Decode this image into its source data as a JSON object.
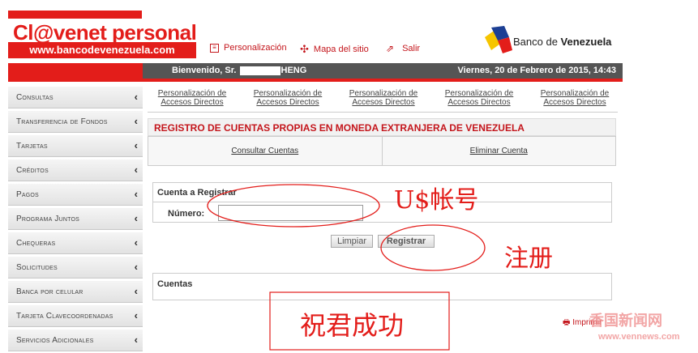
{
  "header": {
    "logo_text": "Cl@venet personal",
    "logo_url": "www.bancodevenezuela.com",
    "bank_name_prefix": "Banco de ",
    "bank_name_bold": "Venezuela",
    "links": [
      {
        "label": "Personalización",
        "icon": "personalize-icon"
      },
      {
        "label": "Mapa del sitio",
        "icon": "sitemap-icon"
      },
      {
        "label": "Salir",
        "icon": "exit-icon"
      }
    ]
  },
  "welcome": {
    "prefix": "Bienvenido, Sr.",
    "suffix": "HENG",
    "date": "Viernes, 20 de Febrero de 2015, 14:43"
  },
  "sidebar": {
    "items": [
      {
        "label": "Consultas"
      },
      {
        "label": "Transferencia de Fondos"
      },
      {
        "label": "Tarjetas"
      },
      {
        "label": "Créditos"
      },
      {
        "label": "Pagos"
      },
      {
        "label": "Programa Juntos"
      },
      {
        "label": "Chequeras"
      },
      {
        "label": "Solicitudes"
      },
      {
        "label": "Banca por celular"
      },
      {
        "label": "Tarjeta Clavecoordenadas"
      },
      {
        "label": "Servicios Adicionales"
      }
    ],
    "chevron": "‹"
  },
  "quick_links": [
    "Personalización de Accesos Directos",
    "Personalización de Accesos Directos",
    "Personalización de Accesos Directos",
    "Personalización de Accesos Directos",
    "Personalización de Accesos Directos"
  ],
  "main": {
    "title": "REGISTRO DE CUENTAS PROPIAS EN MONEDA EXTRANJERA DE VENEZUELA",
    "tabs": [
      "Consultar Cuentas",
      "Eliminar Cuenta"
    ],
    "form_header": "Cuenta a Registrar",
    "numero_label": "Número:",
    "numero_value": "",
    "clear_button": "Limpiar",
    "register_button": "Registrar",
    "cuentas_label": "Cuentas",
    "print_label": "Imprimir"
  },
  "annotations": {
    "account_note": "U$帐号",
    "register_note": "注册",
    "success_note": "祝君成功",
    "color": "#e31d1a"
  },
  "watermark": {
    "line1": "香国新闻网",
    "line2": "www.vennews.com"
  }
}
